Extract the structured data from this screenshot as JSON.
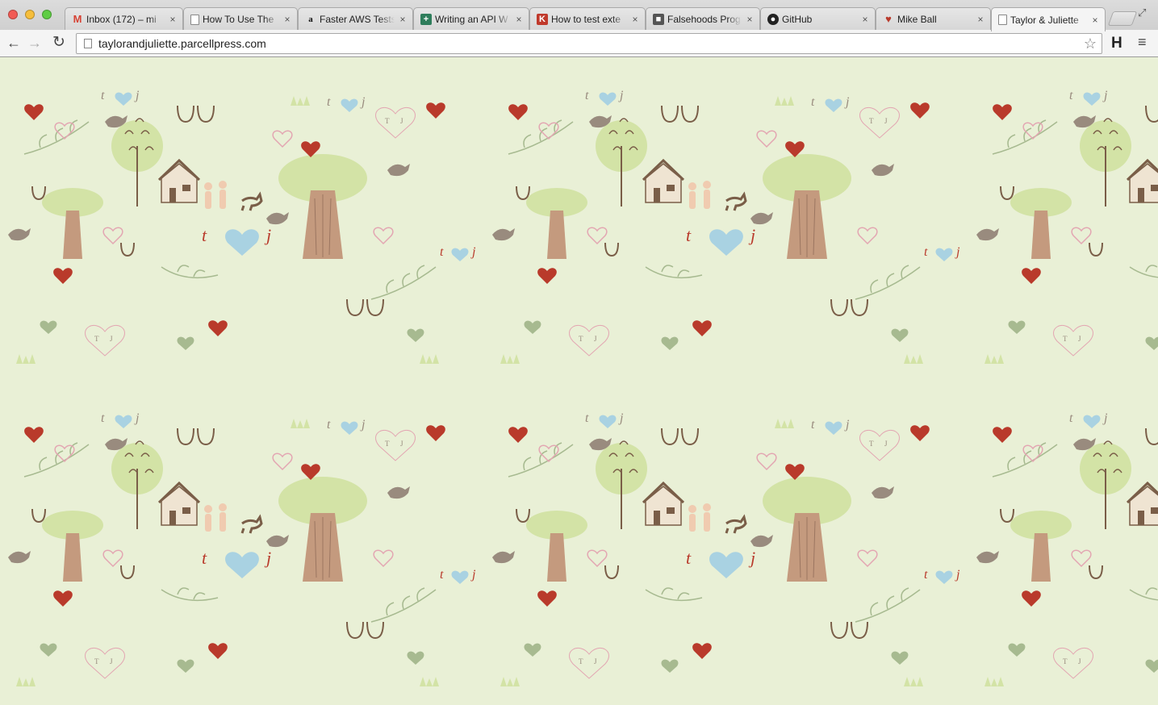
{
  "window": {
    "controls": [
      "close",
      "minimize",
      "zoom"
    ]
  },
  "tabs": [
    {
      "title": "Inbox (172) – mi",
      "icon": "gmail-icon",
      "favicon_glyph": "M",
      "favicon_style": "fav-gmail",
      "active": false
    },
    {
      "title": "How To Use The",
      "icon": "document-icon",
      "favicon_glyph": "",
      "favicon_style": "fav-doc",
      "active": false
    },
    {
      "title": "Faster AWS Tests",
      "icon": "amazon-icon",
      "favicon_glyph": "a",
      "favicon_style": "fav-amazon",
      "active": false
    },
    {
      "title": "Writing an API W",
      "icon": "green-cross-icon",
      "favicon_glyph": "+",
      "favicon_style": "fav-green",
      "active": false
    },
    {
      "title": "How to test exte",
      "icon": "red-site-icon",
      "favicon_glyph": "K",
      "favicon_style": "fav-red",
      "active": false
    },
    {
      "title": "Falsehoods Progr",
      "icon": "dark-site-icon",
      "favicon_glyph": "■",
      "favicon_style": "fav-dark",
      "active": false
    },
    {
      "title": "GitHub",
      "icon": "github-icon",
      "favicon_glyph": "●",
      "favicon_style": "fav-github",
      "active": false
    },
    {
      "title": "Mike Ball",
      "icon": "heart-site-icon",
      "favicon_glyph": "♥",
      "favicon_style": "fav-heart",
      "active": false
    },
    {
      "title": "Taylor & Juliette",
      "icon": "document-icon",
      "favicon_glyph": "",
      "favicon_style": "fav-doc",
      "active": true
    }
  ],
  "toolbar": {
    "back_glyph": "←",
    "forward_glyph": "→",
    "reload_glyph": "↻",
    "url": "taylorandjuliette.parcellpress.com",
    "bookmark_glyph": "☆",
    "extension_label": "H",
    "menu_glyph": "≡",
    "close_glyph": "×",
    "fullscreen_glyph": "⤢"
  },
  "page": {
    "pattern_text": {
      "t": "t",
      "j": "j",
      "T": "T",
      "J": "J"
    },
    "colors": {
      "background": "#e9f0d6",
      "tree_foliage": "#d3e3a6",
      "tree_trunk": "#c49a7e",
      "brown": "#7a5e48",
      "red_heart": "#b93a2b",
      "blue_heart": "#a9d2e2",
      "sage": "#a7ba90",
      "taupe": "#998b7e",
      "peach": "#f0cbb0",
      "pink": "#e3a6b2"
    }
  }
}
